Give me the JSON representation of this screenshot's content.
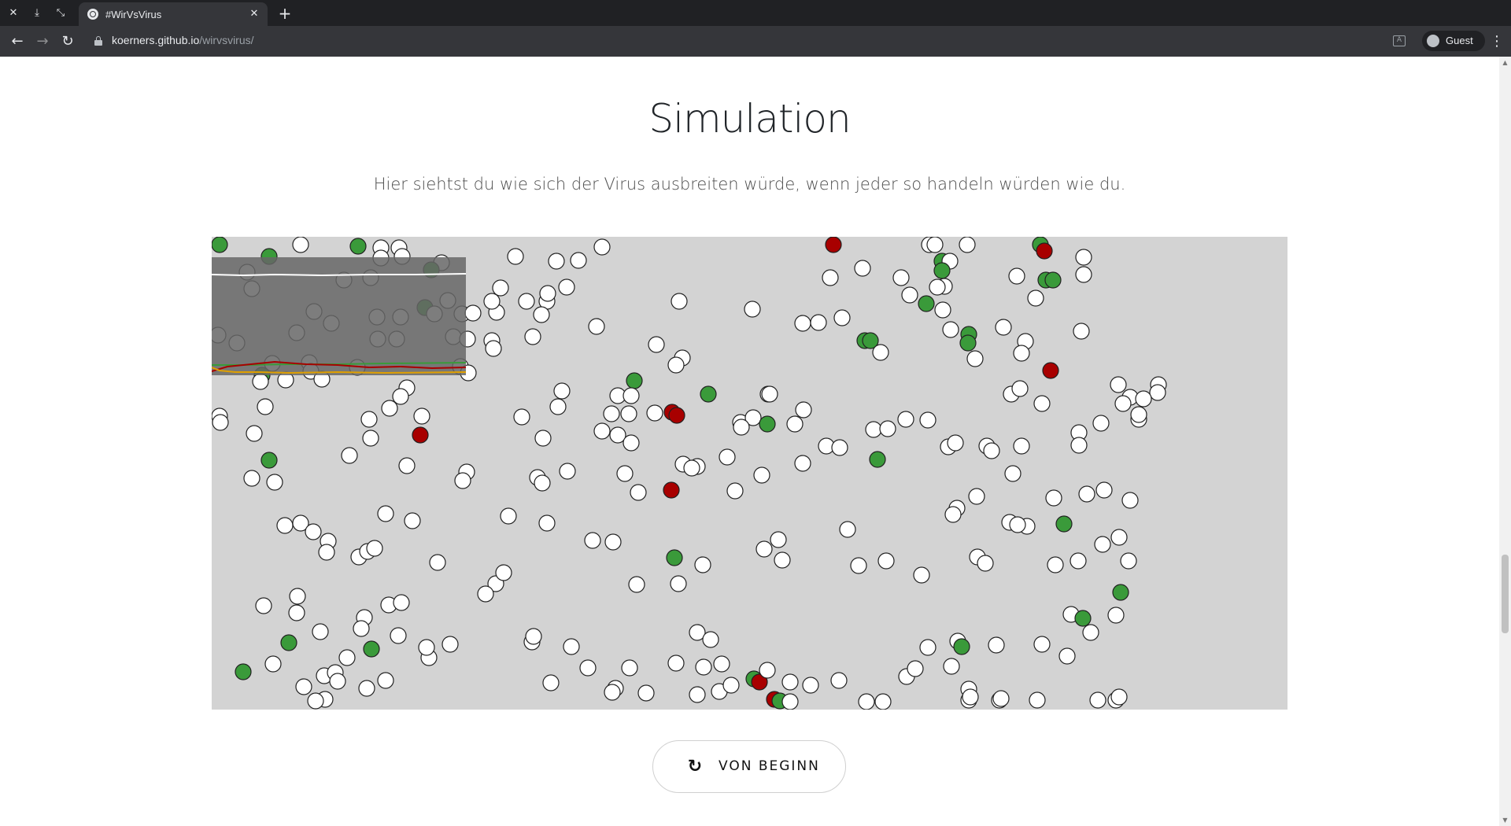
{
  "browser": {
    "tab_title": "#WirVsVirus",
    "url_host": "koerners.github.io",
    "url_path": "/wirvsvirus/",
    "profile_label": "Guest"
  },
  "page": {
    "heading": "Simulation",
    "subtitle": "Hier siehtst du wie sich der Virus ausbreiten würde, wenn jeder so handeln würden wie du.",
    "restart_label": "VON BEGINN"
  },
  "colors": {
    "canvas_bg": "#d3d3d3",
    "healthy": "#ffffff",
    "infected": "#a80000",
    "recovered": "#3a9a3a",
    "chart_overlay": "#666666"
  },
  "icons": {
    "restart": "redo-icon",
    "lock": "lock-icon",
    "translate": "translate-icon"
  }
}
